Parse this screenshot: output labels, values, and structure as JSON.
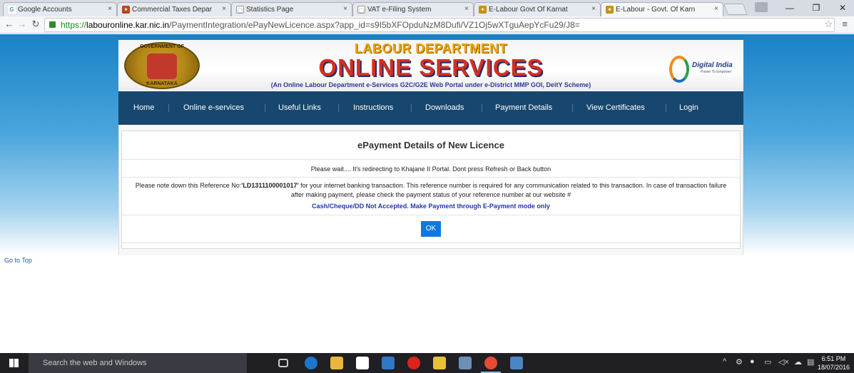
{
  "browser": {
    "tabs": [
      {
        "label": "Google Accounts",
        "favicon": "G",
        "fav_color": "#4285f4"
      },
      {
        "label": "Commercial Taxes Depar",
        "favicon": "✦",
        "fav_color": "#b6461a"
      },
      {
        "label": "Statistics Page",
        "favicon": "▢",
        "fav_color": "#999999"
      },
      {
        "label": "VAT e-Filing System",
        "favicon": "▢",
        "fav_color": "#999999"
      },
      {
        "label": "E-Labour Govt Of Karnat",
        "favicon": "✦",
        "fav_color": "#c79016"
      },
      {
        "label": "E-Labour - Govt. Of Karn",
        "favicon": "✦",
        "fav_color": "#c79016"
      }
    ],
    "url_protocol": "https://",
    "url_host": "labouronline.kar.nic.in",
    "url_path": "/PaymentIntegration/ePayNewLicence.aspx?app_id=s9I5bXFOpduNzM8Dufi/VZ1Oj5wXTguAepYcFu29/J8="
  },
  "header": {
    "emblem_top": "GOVERNMENT OF",
    "emblem_bottom": "KARNATAKA",
    "department": "LABOUR DEPARTMENT",
    "title": "ONLINE SERVICES",
    "tagline": "(An Online Labour Department e-Services G2C/G2E Web Portal under e-District MMP GOI, DeitY Scheme)",
    "digital_india": "Digital India",
    "digital_india_sub": "Power To Empower"
  },
  "nav": {
    "items": [
      "Home",
      "Online e-services",
      "Useful Links",
      "Instructions",
      "Downloads",
      "Payment Details",
      "View Certificates",
      "Login"
    ]
  },
  "main": {
    "heading": "ePayment Details of New Licence",
    "wait_msg": "Please wait.... It's redirecting to Khajane II Portal. Dont press Refresh or Back button",
    "note_prefix": "Please note down this Reference No:",
    "reference_no": "'LD1311100001017'",
    "note_suffix": " for your internet banking transaction. This reference number is required for any communication related to this transaction. In case of transaction failure after making payment, please check the payment status of your reference number at our website #",
    "cash_msg": "Cash/Cheque/DD Not Accepted. Make Payment through E-Payment mode only",
    "ok_label": "OK"
  },
  "footer": {
    "go_top": "Go to Top"
  },
  "taskbar": {
    "search_placeholder": "Search the web and Windows",
    "time": "6:51 PM",
    "date": "18/07/2016"
  },
  "colors": {
    "nav_bg": "#17476e",
    "ok_button": "#0c79e0",
    "title_red": "#d4301e",
    "dept_orange": "#f2a400"
  }
}
